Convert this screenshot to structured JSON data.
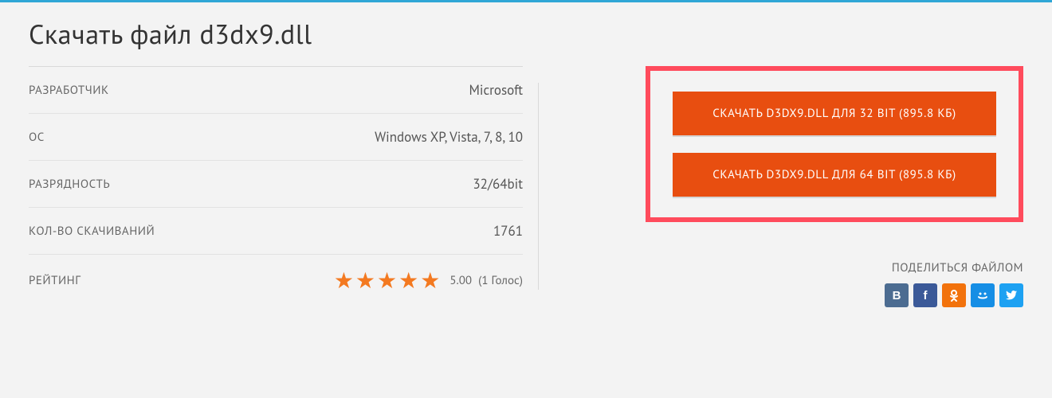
{
  "title": "Скачать файл d3dx9.dll",
  "details": {
    "developer_label": "РАЗРАБОТЧИК",
    "developer_value": "Microsoft",
    "os_label": "ОС",
    "os_value": "Windows XP, Vista, 7, 8, 10",
    "bitness_label": "РАЗРЯДНОСТЬ",
    "bitness_value": "32/64bit",
    "downloads_label": "КОЛ-ВО СКАЧИВАНИЙ",
    "downloads_value": "1761",
    "rating_label": "РЕЙТИНГ",
    "rating_score": "5.00",
    "rating_votes": "(1 Голос)",
    "stars": 5
  },
  "downloads": {
    "btn32": "СКАЧАТЬ D3DX9.DLL ДЛЯ 32 BIT (895.8 КБ)",
    "btn64": "СКАЧАТЬ D3DX9.DLL ДЛЯ 64 BIT (895.8 КБ)"
  },
  "share": {
    "title": "ПОДЕЛИТЬСЯ ФАЙЛОМ",
    "networks": [
      "vk",
      "fb",
      "ok",
      "mm",
      "tw"
    ]
  }
}
